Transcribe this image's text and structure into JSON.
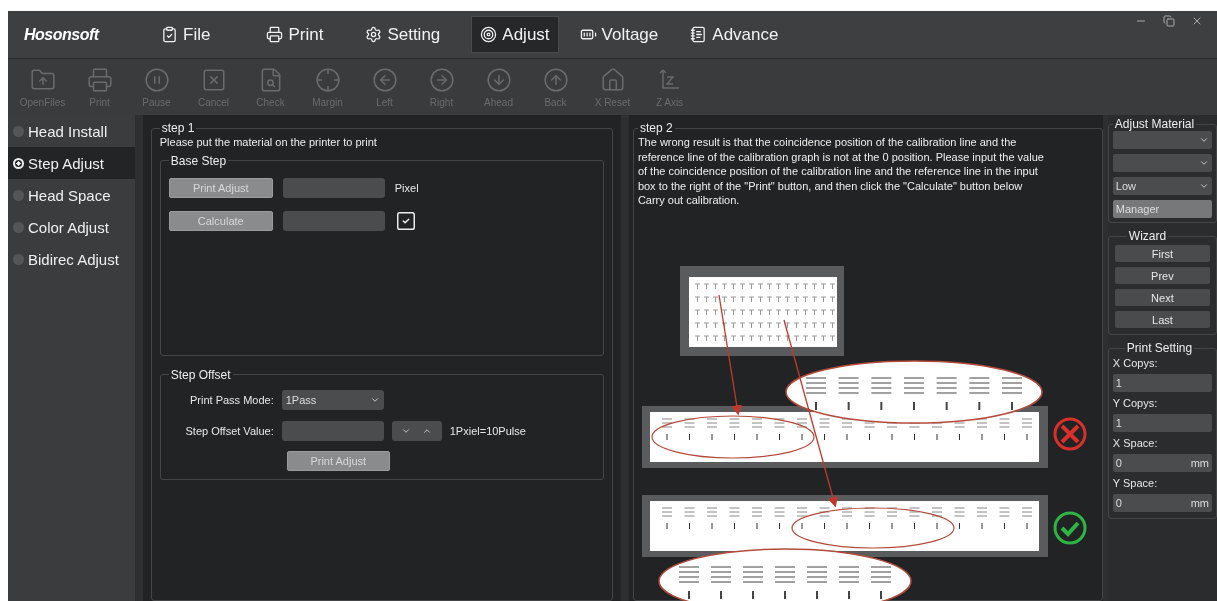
{
  "window": {
    "logo": "Hosonsoft"
  },
  "menu": [
    {
      "label": "File",
      "selected": false
    },
    {
      "label": "Print",
      "selected": false
    },
    {
      "label": "Setting",
      "selected": false
    },
    {
      "label": "Adjust",
      "selected": true
    },
    {
      "label": "Voltage",
      "selected": false
    },
    {
      "label": "Advance",
      "selected": false
    }
  ],
  "toolbar": [
    {
      "label": "OpenFiles",
      "disabled": true
    },
    {
      "label": "Print",
      "disabled": true
    },
    {
      "label": "Pause",
      "disabled": true
    },
    {
      "label": "Cancel",
      "disabled": true
    },
    {
      "label": "Check",
      "disabled": true
    },
    {
      "label": "Margin",
      "disabled": true
    },
    {
      "label": "Left",
      "disabled": true
    },
    {
      "label": "Right",
      "disabled": true
    },
    {
      "label": "Ahead",
      "disabled": true
    },
    {
      "label": "Back",
      "disabled": true
    },
    {
      "label": "X Reset",
      "disabled": true
    },
    {
      "label": "Z Axis",
      "disabled": true
    }
  ],
  "sidebar": {
    "items": [
      {
        "label": "Head Install",
        "selected": false
      },
      {
        "label": "Step Adjust",
        "selected": true
      },
      {
        "label": "Head Space",
        "selected": false
      },
      {
        "label": "Color Adjust",
        "selected": false
      },
      {
        "label": "Bidirec Adjust",
        "selected": false
      }
    ]
  },
  "step1": {
    "title": "step 1",
    "instruction": "Please put the material on the printer to print",
    "base_step": {
      "title": "Base Step",
      "print_button": "Print Adjust",
      "unit": "Pixel",
      "calculate_button": "Calculate",
      "checked": true
    },
    "step_offset": {
      "title": "Step Offset",
      "pass_mode_label": "Print Pass Mode:",
      "pass_mode": "1Pass",
      "offset_label": "Step Offset Value:",
      "unit_note": "1Pxiel=10Pulse",
      "print_button": "Print Adjust"
    }
  },
  "step2": {
    "title": "step 2",
    "text": "The wrong result is that the coincidence position of the calibration line and the reference line of the calibration graph is not at the 0 position. Please input the value of the coincidence position of the calibration line and the reference line in the input box to the right of the \"Print\" button, and then click the \"Calculate\" button below Carry out calibration."
  },
  "adjust_material": {
    "title": "Adjust Material",
    "level_value": "Low",
    "manager": "Manager"
  },
  "wizard": {
    "title": "Wizard",
    "buttons": [
      "First",
      "Prev",
      "Next",
      "Last"
    ]
  },
  "print_setting": {
    "title": "Print Setting",
    "fields": [
      {
        "label": "X Copys:",
        "value": "1"
      },
      {
        "label": "Y Copys:",
        "value": "1"
      },
      {
        "label": "X Space:",
        "value": "0",
        "unit": "mm"
      },
      {
        "label": "Y Space:",
        "value": "0",
        "unit": "mm"
      }
    ]
  }
}
